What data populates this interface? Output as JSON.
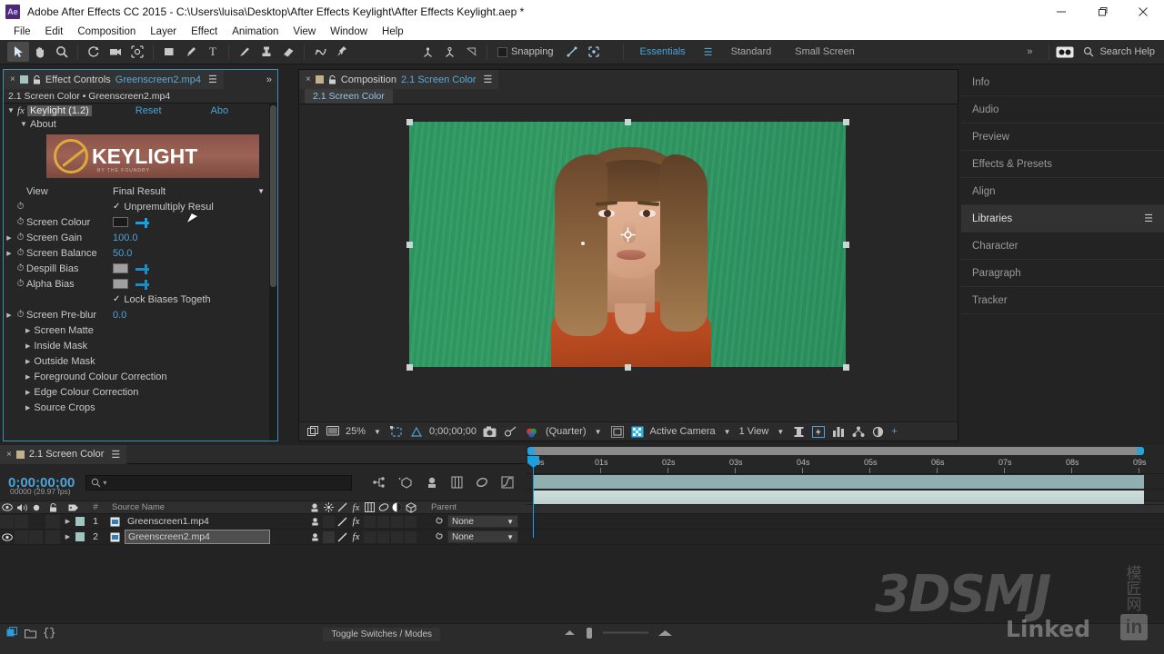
{
  "window": {
    "app_icon": "Ae",
    "title": "Adobe After Effects CC 2015 - C:\\Users\\luisa\\Desktop\\After Effects Keylight\\After Effects Keylight.aep *",
    "minimize": "—",
    "maximize": "❐",
    "close": "✕"
  },
  "menubar": {
    "items": [
      "File",
      "Edit",
      "Composition",
      "Layer",
      "Effect",
      "Animation",
      "View",
      "Window",
      "Help"
    ]
  },
  "toolbar": {
    "tools": [
      {
        "name": "selection-tool",
        "glyph": "➤",
        "selected": true
      },
      {
        "name": "hand-tool",
        "glyph": "✋",
        "selected": false
      },
      {
        "name": "zoom-tool",
        "glyph": "🔍",
        "selected": false
      },
      {
        "name": "rotation-tool",
        "glyph": "↻",
        "selected": false
      },
      {
        "name": "camera-tool",
        "glyph": "🎥",
        "selected": false
      },
      {
        "name": "pan-behind-tool",
        "glyph": "⌖",
        "selected": false
      },
      {
        "name": "shape-tool",
        "glyph": "▢",
        "selected": false
      },
      {
        "name": "pen-tool",
        "glyph": "✒",
        "selected": false
      },
      {
        "name": "type-tool",
        "glyph": "T",
        "selected": false
      },
      {
        "name": "brush-tool",
        "glyph": "/",
        "selected": false
      },
      {
        "name": "clone-stamp-tool",
        "glyph": "⚲",
        "selected": false
      },
      {
        "name": "eraser-tool",
        "glyph": "◰",
        "selected": false
      },
      {
        "name": "roto-brush-tool",
        "glyph": "✎",
        "selected": false
      },
      {
        "name": "puppet-pin-tool",
        "glyph": "📌",
        "selected": false
      }
    ],
    "axis_tools": [
      {
        "name": "local-axis-mode",
        "glyph": "⤬"
      },
      {
        "name": "world-axis-mode",
        "glyph": "⤮"
      },
      {
        "name": "view-axis-mode",
        "glyph": "⌀"
      }
    ],
    "snapping_label": "Snapping",
    "snap_extra": [
      {
        "name": "snap-align-icon",
        "glyph": "⤢"
      },
      {
        "name": "snap-grid-icon",
        "glyph": "⛶"
      }
    ],
    "workspaces": [
      {
        "label": "Essentials",
        "active": true
      },
      {
        "label": "Standard",
        "active": false
      },
      {
        "label": "Small Screen",
        "active": false
      }
    ],
    "overflow": "»",
    "sync_icon": "◉◉",
    "search_icon": "search-icon",
    "search_label": "Search Help"
  },
  "effect_controls": {
    "tab": {
      "close": "×",
      "lock": "🔒",
      "title": "Effect Controls",
      "subtitle": "Greenscreen2.mp4",
      "menu": "☰"
    },
    "overflow": "»",
    "breadcrumb": "2.1 Screen Color • Greenscreen2.mp4",
    "effect": {
      "expand": "▼",
      "fx": "fx",
      "name": "Keylight (1.2)",
      "reset": "Reset",
      "about": "Abo"
    },
    "about_row": {
      "expand": "▼",
      "label": "About"
    },
    "logo": {
      "word": "KEYLIGHT",
      "tagline": "BY THE FOUNDRY"
    },
    "params": [
      {
        "label": "View",
        "value": "Final Result",
        "type": "dropdown"
      },
      {
        "label": "",
        "value": "Unpremultiply Resul",
        "type": "checkbox",
        "checked": true,
        "stopwatch": true
      },
      {
        "label": "Screen Colour",
        "value": "",
        "type": "color",
        "stopwatch": true,
        "swatch": "#1a1a1a"
      },
      {
        "label": "Screen Gain",
        "value": "100.0",
        "type": "number",
        "stopwatch": true,
        "expandable": true
      },
      {
        "label": "Screen Balance",
        "value": "50.0",
        "type": "number",
        "stopwatch": true,
        "expandable": true
      },
      {
        "label": "Despill Bias",
        "value": "",
        "type": "color",
        "stopwatch": true,
        "swatch": "#a0a0a0"
      },
      {
        "label": "Alpha Bias",
        "value": "",
        "type": "color",
        "stopwatch": true,
        "swatch": "#a0a0a0"
      },
      {
        "label": "",
        "value": "Lock Biases Togeth",
        "type": "checkbox",
        "checked": true
      },
      {
        "label": "Screen Pre-blur",
        "value": "0.0",
        "type": "number",
        "stopwatch": true,
        "expandable": true
      }
    ],
    "groups": [
      "Screen Matte",
      "Inside Mask",
      "Outside Mask",
      "Foreground Colour Correction",
      "Edge Colour Correction",
      "Source Crops"
    ]
  },
  "composition": {
    "tab": {
      "close": "×",
      "lock": "🔒",
      "title": "Composition",
      "subtitle": "2.1 Screen Color",
      "menu": "☰"
    },
    "subtab": "2.1 Screen Color",
    "bottom_bar": {
      "zoom": "25%",
      "zoom_arrow": "▼",
      "timecode": "0;00;00;00",
      "resolution": "(Quarter)",
      "resolution_arrow": "▼",
      "camera": "Active Camera",
      "camera_arrow": "▼",
      "views": "1 View",
      "views_arrow": "▼",
      "icons": [
        {
          "name": "always-preview-icon",
          "glyph": "▣"
        },
        {
          "name": "main-view-icon",
          "glyph": "🖵"
        },
        {
          "name": "region-of-interest-icon",
          "glyph": "⊞"
        },
        {
          "name": "transparency-grid-icon",
          "glyph": "◪"
        },
        {
          "name": "take-snapshot-icon",
          "glyph": "📷"
        },
        {
          "name": "show-snapshot-icon",
          "glyph": "👁"
        },
        {
          "name": "channel-rgb-icon",
          "glyph": "❀"
        },
        {
          "name": "toggle-mask-icon",
          "glyph": "▣"
        },
        {
          "name": "toggle-transparency-icon",
          "glyph": "▦"
        },
        {
          "name": "timeline-icon",
          "glyph": "⧗"
        },
        {
          "name": "fast-previews-icon",
          "glyph": "⚡"
        },
        {
          "name": "renderer-options-icon",
          "glyph": "▥"
        },
        {
          "name": "composition-flowchart-icon",
          "glyph": "⁂"
        },
        {
          "name": "reset-exposure-icon",
          "glyph": "◐"
        },
        {
          "name": "adjust-exposure-icon",
          "glyph": "+"
        }
      ]
    }
  },
  "right_sidebar": {
    "panels": [
      {
        "label": "Info",
        "active": false
      },
      {
        "label": "Audio",
        "active": false
      },
      {
        "label": "Preview",
        "active": false
      },
      {
        "label": "Effects & Presets",
        "active": false
      },
      {
        "label": "Align",
        "active": false
      },
      {
        "label": "Libraries",
        "active": true,
        "menu": "☰"
      },
      {
        "label": "Character",
        "active": false
      },
      {
        "label": "Paragraph",
        "active": false
      },
      {
        "label": "Tracker",
        "active": false
      }
    ]
  },
  "timeline": {
    "tab": {
      "close": "×",
      "title": "2.1 Screen Color",
      "menu": "☰"
    },
    "timecode": "0;00;00;00",
    "frame_info": "00000 (29.97 fps)",
    "search_placeholder": "",
    "search_icon": "search-icon",
    "tool_icons": [
      {
        "name": "composition-mini-flowchart-icon",
        "glyph": "⋔"
      },
      {
        "name": "draft-3d-icon",
        "glyph": "✦"
      },
      {
        "name": "hide-shy-layers-icon",
        "glyph": "⚗"
      },
      {
        "name": "frame-blending-icon",
        "glyph": "▤"
      },
      {
        "name": "motion-blur-icon",
        "glyph": "◯"
      },
      {
        "name": "graph-editor-icon",
        "glyph": "◺"
      }
    ],
    "columns": {
      "eye": "👁",
      "audio": "🔊",
      "solo": "●",
      "lock": "🔒",
      "label": "◆",
      "number": "#",
      "source_name": "Source Name",
      "switches": [
        "⚙",
        "✳",
        "＼",
        "fx",
        "▤",
        "◯",
        "◑",
        "⬡"
      ],
      "parent": "Parent"
    },
    "layers": [
      {
        "index": "1",
        "name": "Greenscreen1.mp4",
        "visible": false,
        "selected": false,
        "parent": "None"
      },
      {
        "index": "2",
        "name": "Greenscreen2.mp4",
        "visible": true,
        "selected": true,
        "parent": "None"
      }
    ],
    "ruler_ticks": [
      "0s",
      "01s",
      "02s",
      "03s",
      "04s",
      "05s",
      "06s",
      "07s",
      "08s",
      "09s"
    ],
    "footer_label": "Toggle Switches / Modes"
  },
  "status_bar": {
    "icons": [
      {
        "name": "new-composition-icon",
        "glyph": "▣"
      },
      {
        "name": "new-folder-icon",
        "glyph": "🗀"
      },
      {
        "name": "expression-icon",
        "glyph": "{}"
      }
    ]
  },
  "watermark": {
    "brand": "3DSMJ",
    "chinese": "模匠网",
    "linked": "Linked",
    "in": "in"
  },
  "colors": {
    "accent_blue": "#4ba3d8",
    "panel_bg": "#232323",
    "tab_bg": "#2b2b2b",
    "greenscreen": "#2e9962",
    "keylight_red": "#9b6255",
    "keylight_gold": "#e0a93c"
  }
}
